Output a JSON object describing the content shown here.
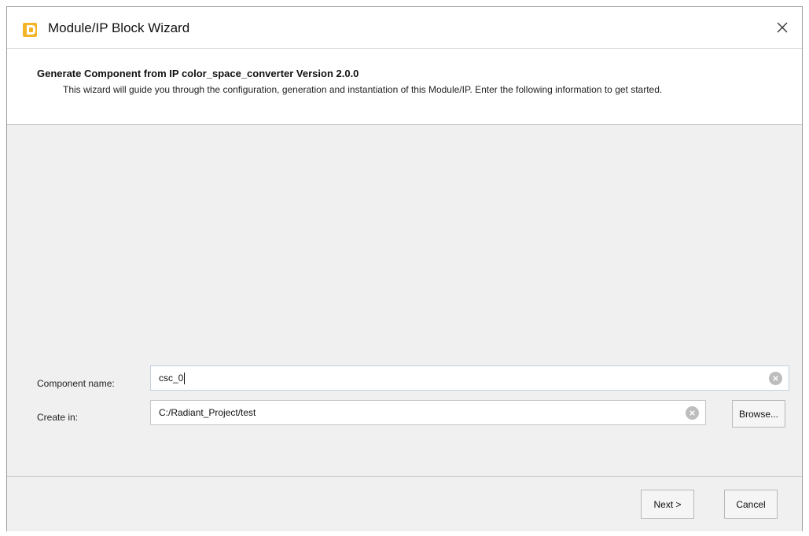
{
  "window": {
    "title": "Module/IP Block Wizard"
  },
  "header": {
    "title": "Generate Component from IP color_space_converter Version 2.0.0",
    "description": "This wizard will guide you through the configuration, generation and instantiation of this Module/IP. Enter the following information to get started."
  },
  "form": {
    "component_name_label": "Component name:",
    "component_name_value": "csc_0",
    "create_in_label": "Create in:",
    "create_in_value": "C:/Radiant_Project/test",
    "browse_label": "Browse..."
  },
  "footer": {
    "next_label": "Next >",
    "cancel_label": "Cancel"
  },
  "colors": {
    "app_icon": "#f5b425",
    "dialog_background": "#f0f0f0"
  }
}
